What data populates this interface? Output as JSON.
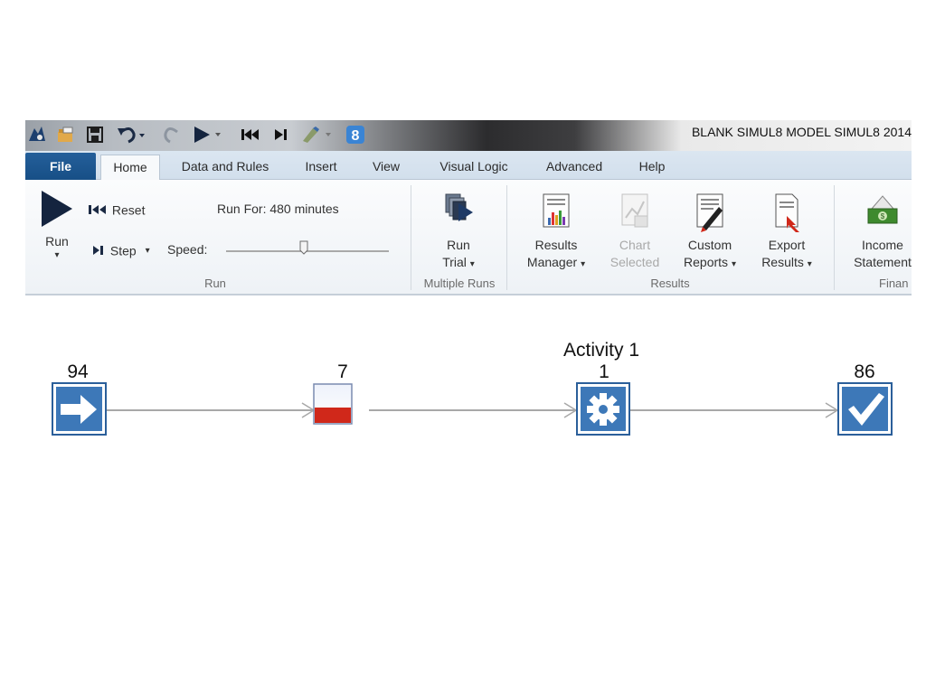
{
  "window": {
    "title": "BLANK SIMUL8 MODEL   SIMUL8 2014",
    "quick_access_icons": [
      "app-logo-icon",
      "open-folder-icon",
      "save-icon",
      "undo-icon",
      "redo-icon",
      "play-icon",
      "rewind-icon",
      "step-icon",
      "paint-icon",
      "simul8-badge-icon"
    ]
  },
  "tabs": [
    "File",
    "Home",
    "Data and Rules",
    "Insert",
    "View",
    "Visual Logic",
    "Advanced",
    "Help"
  ],
  "active_tab": "Home",
  "ribbon": {
    "run_group": {
      "label": "Run",
      "run_label": "Run",
      "reset_label": "Reset",
      "step_label": "Step",
      "speed_label": "Speed:",
      "run_for_text": "Run For: 480 minutes",
      "speed_value": 0.48
    },
    "multiple_runs_group": {
      "label": "Multiple Runs",
      "trial_line1": "Run",
      "trial_line2": "Trial"
    },
    "results_group": {
      "label": "Results",
      "results_manager_line1": "Results",
      "results_manager_line2": "Manager",
      "chart_selected_line1": "Chart",
      "chart_selected_line2": "Selected",
      "custom_reports_line1": "Custom",
      "custom_reports_line2": "Reports",
      "export_results_line1": "Export",
      "export_results_line2": "Results"
    },
    "finance_group": {
      "label": "Finan",
      "income_line1": "Income",
      "income_line2": "Statement"
    }
  },
  "diagram": {
    "entry": {
      "count": "94"
    },
    "queue": {
      "count": "7",
      "fill": 0.4
    },
    "activity": {
      "name": "Activity 1",
      "count": "1"
    },
    "exit": {
      "count": "86"
    },
    "colors": {
      "icon_blue": "#3d78b8",
      "icon_border": "#2b5f9a",
      "queue_red": "#d0281a"
    }
  }
}
